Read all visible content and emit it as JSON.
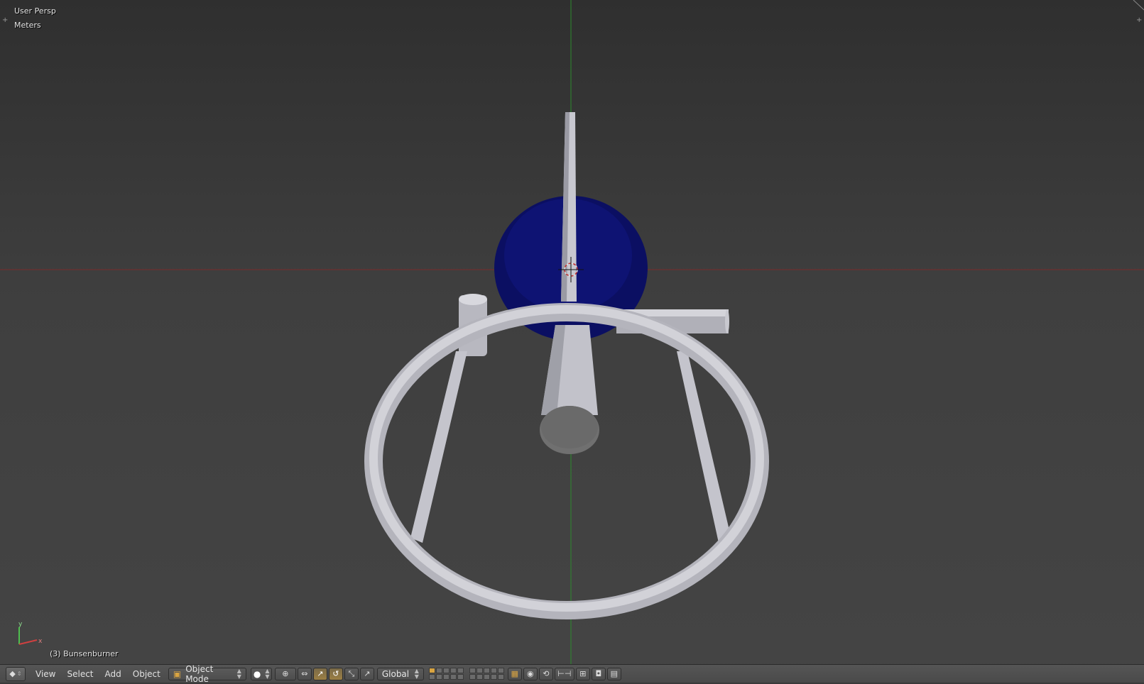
{
  "viewport": {
    "perspective_label": "User Persp",
    "units_label": "Meters",
    "object_label": "(3) Bunsenburner",
    "axis_gizmo": {
      "y_label": "y",
      "x_label": "x"
    }
  },
  "header": {
    "editor_type_icon": "3d-view-icon",
    "menus": [
      "View",
      "Select",
      "Add",
      "Object"
    ],
    "mode": "Object Mode",
    "pivot_icon": "pivot-point-icon",
    "orientation": "Global"
  },
  "colors": {
    "viewport_bg": "#3a3a3a",
    "grid_x_axis": "#8a2a2a",
    "grid_y_axis": "#2f8a2f",
    "sphere": "#0d1166",
    "mesh": "#c9c9d1"
  }
}
